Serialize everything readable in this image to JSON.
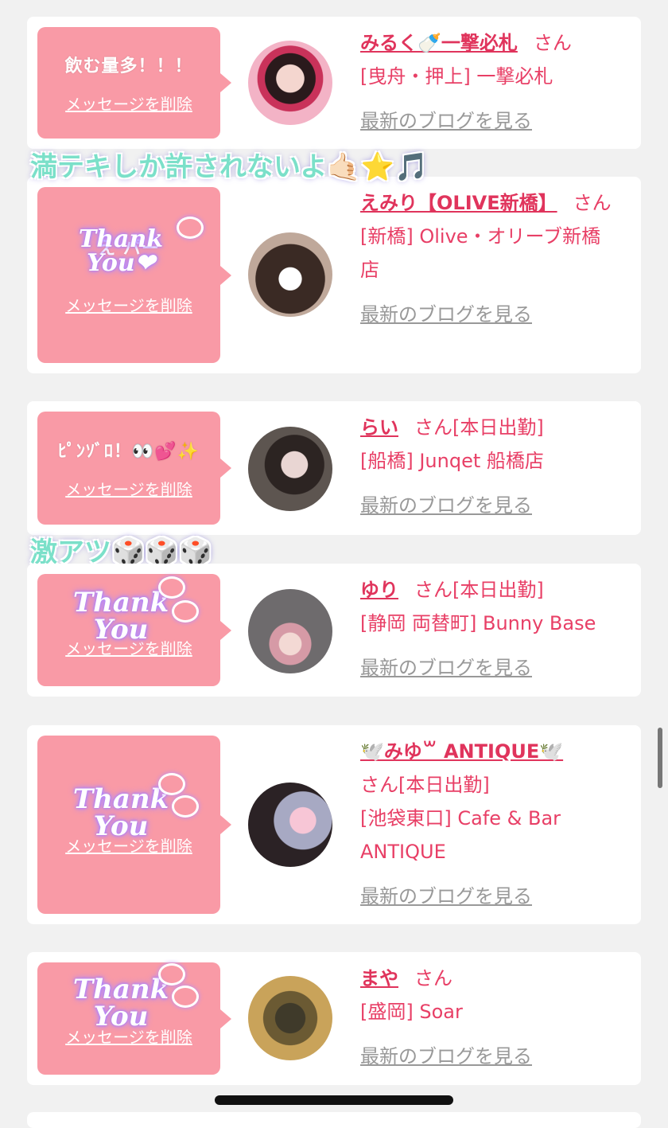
{
  "delete_label": "メッセージを削除",
  "san_label": "さん",
  "blog_label": "最新のブログを見る",
  "cards": [
    {
      "message": "飲む量多！！！",
      "name": "みるく🍼一撃必札",
      "suffix": "",
      "shop": "[曳舟・押上] 一撃必札",
      "shop2": ""
    },
    {
      "message": "え   パー",
      "thank_text": "Thank You❤",
      "name": "えみり【OLIVE新橋】",
      "suffix": "",
      "shop": "[新橋] Olive・オリーブ新橋",
      "shop2": "店"
    },
    {
      "message": "ﾋﾟﾝｿﾞﾛ！👀💕✨",
      "name": "らい",
      "suffix": "[本日出勤]",
      "shop": "[船橋] Junqet 船橋店",
      "shop2": ""
    },
    {
      "message": "",
      "thank_text": "Thank You",
      "name": "ゆり",
      "suffix": "[本日出勤]",
      "shop": "[静岡 両替町] Bunny Base",
      "shop2": ""
    },
    {
      "message": "",
      "thank_text": "Thank You",
      "name": "🕊️みゆ꒳ ANTIQUE🕊️",
      "suffix": "[本日出勤]",
      "shop": "[池袋東口] Cafe & Bar",
      "shop2": "ANTIQUE"
    },
    {
      "message": "",
      "thank_text": "Thank You",
      "name": "まや",
      "suffix": "",
      "shop": "[盛岡] Soar",
      "shop2": ""
    }
  ],
  "overlays": {
    "text1": "満テキしか許されないよ🤙🏻⭐️🎵",
    "text2": "激アツ🎲🎲🎲"
  },
  "colors": {
    "bubble": "#f99aa6",
    "name": "#e0345c",
    "text": "#e83f66",
    "overlay": "#7be0c9"
  }
}
